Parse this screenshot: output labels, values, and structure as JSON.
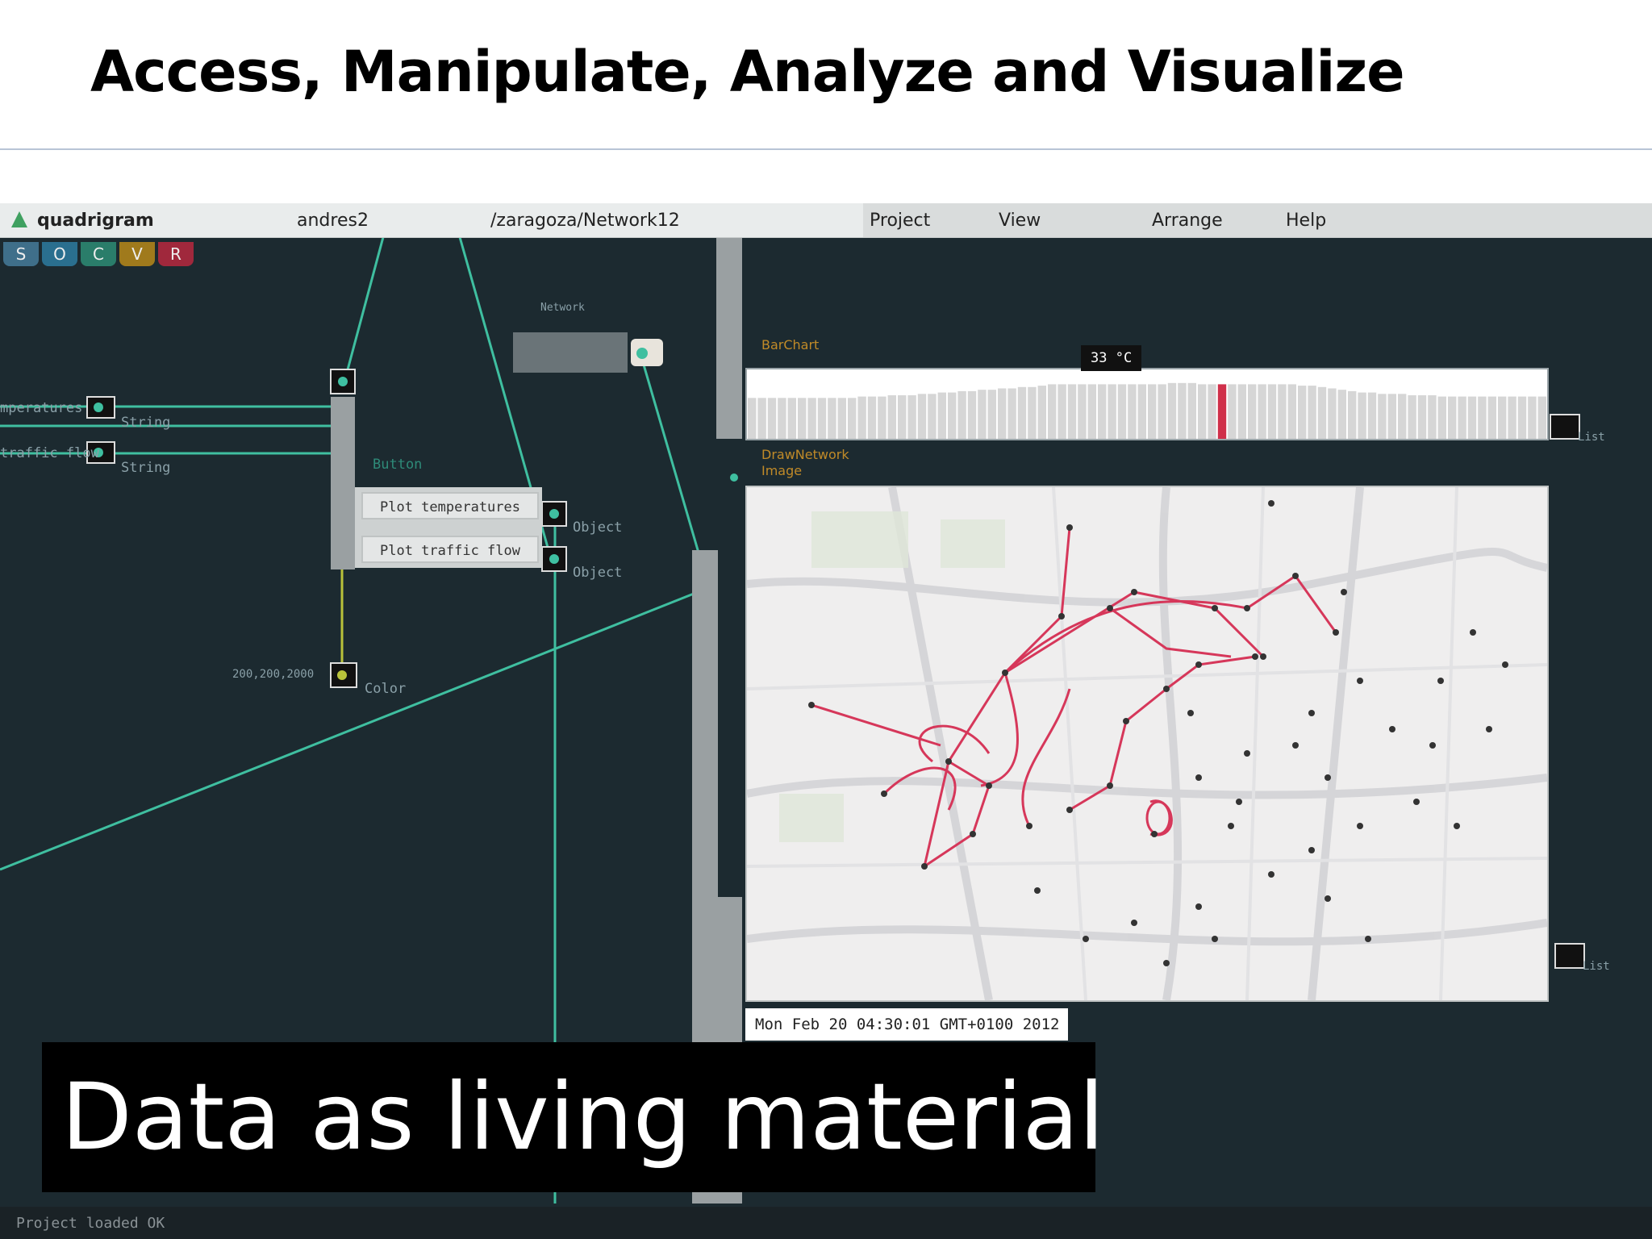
{
  "slide": {
    "title": "Access, Manipulate, Analyze and Visualize",
    "caption": "Data as living material"
  },
  "menubar": {
    "app_name": "quadrigram",
    "user": "andres2",
    "path": "/zaragoza/Network12",
    "menus": [
      "Project",
      "View",
      "Arrange",
      "Help"
    ]
  },
  "mode_buttons": [
    {
      "label": "S",
      "color": "#3f6f8a"
    },
    {
      "label": "O",
      "color": "#2a6f8f"
    },
    {
      "label": "C",
      "color": "#2a7d6a"
    },
    {
      "label": "V",
      "color": "#a07a1c"
    },
    {
      "label": "R",
      "color": "#a0283c"
    }
  ],
  "nodes": {
    "temperatures_label": "mperatures",
    "traffic_label": "traffic flow",
    "string1": "String",
    "string2": "String",
    "button_label": "Button",
    "plot_temperatures": "Plot temperatures",
    "plot_traffic": "Plot traffic flow",
    "object1": "Object",
    "object2": "Object",
    "color_value": "200,200,2000",
    "color_label": "Color",
    "network_label": "Network",
    "barchart_label": "BarChart",
    "drawnetwork_label": "DrawNetwork",
    "image_label": "Image",
    "list1": "List",
    "list2": "List"
  },
  "barchart": {
    "tooltip": "33 °C",
    "highlight_color": "#d0304a",
    "bar_color": "#d6d6d6",
    "values": [
      30,
      30,
      30,
      30,
      30,
      30,
      30,
      30,
      30,
      30,
      30,
      31,
      31,
      31,
      32,
      32,
      32,
      33,
      33,
      34,
      34,
      35,
      35,
      36,
      36,
      37,
      37,
      38,
      38,
      39,
      40,
      40,
      40,
      40,
      40,
      40,
      40,
      40,
      40,
      40,
      40,
      40,
      41,
      41,
      41,
      40,
      40,
      40,
      40,
      40,
      40,
      40,
      40,
      40,
      40,
      39,
      39,
      38,
      37,
      36,
      35,
      34,
      34,
      33,
      33,
      33,
      32,
      32,
      32,
      31,
      31,
      31,
      31,
      31,
      31,
      31,
      31,
      31,
      31,
      31
    ],
    "highlight_index": 47
  },
  "map": {
    "node_color": "#333333",
    "edge_color": "#d6375a"
  },
  "timestamp": "Mon Feb 20 04:30:01 GMT+0100 2012",
  "status": "Project loaded OK"
}
